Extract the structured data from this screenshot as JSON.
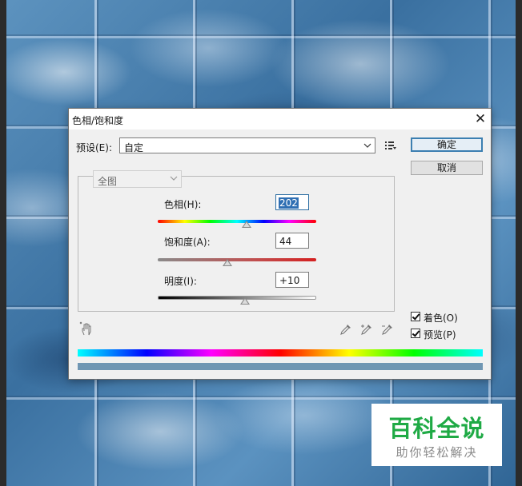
{
  "dialog": {
    "title": "色相/饱和度",
    "close_glyph": "✕",
    "preset_label": "预设(E):",
    "preset_value": "自定",
    "ok_label": "确定",
    "cancel_label": "取消",
    "edit_value": "全图",
    "hue": {
      "label": "色相(H):",
      "value": "202",
      "slider_fraction": 0.56
    },
    "saturation": {
      "label": "饱和度(A):",
      "value": "44",
      "slider_fraction": 0.44
    },
    "lightness": {
      "label": "明度(I):",
      "value": "+10",
      "slider_fraction": 0.55
    },
    "colorize": {
      "label": "着色(O)",
      "checked": true
    },
    "preview": {
      "label": "预览(P)",
      "checked": true
    }
  },
  "watermark": {
    "main": "百科全说",
    "sub": "助你轻松解决",
    "color": "#1faa45"
  }
}
